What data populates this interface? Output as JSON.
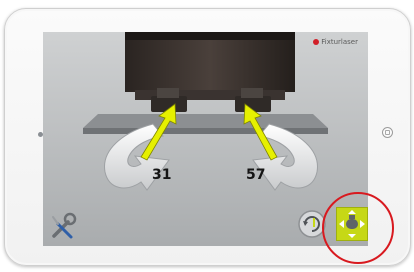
{
  "app": {
    "brand": "Fixturlaser"
  },
  "adjustments": {
    "left_value": "31",
    "right_value": "57"
  },
  "toolbar": {
    "tools_icon": "wrench-screwdriver-icon",
    "reset_icon": "rotate-refresh-icon",
    "move_icon": "machine-move-icon"
  },
  "colors": {
    "accent": "#c6d816",
    "highlight": "#d8191f",
    "arrow": "#e6f000"
  }
}
